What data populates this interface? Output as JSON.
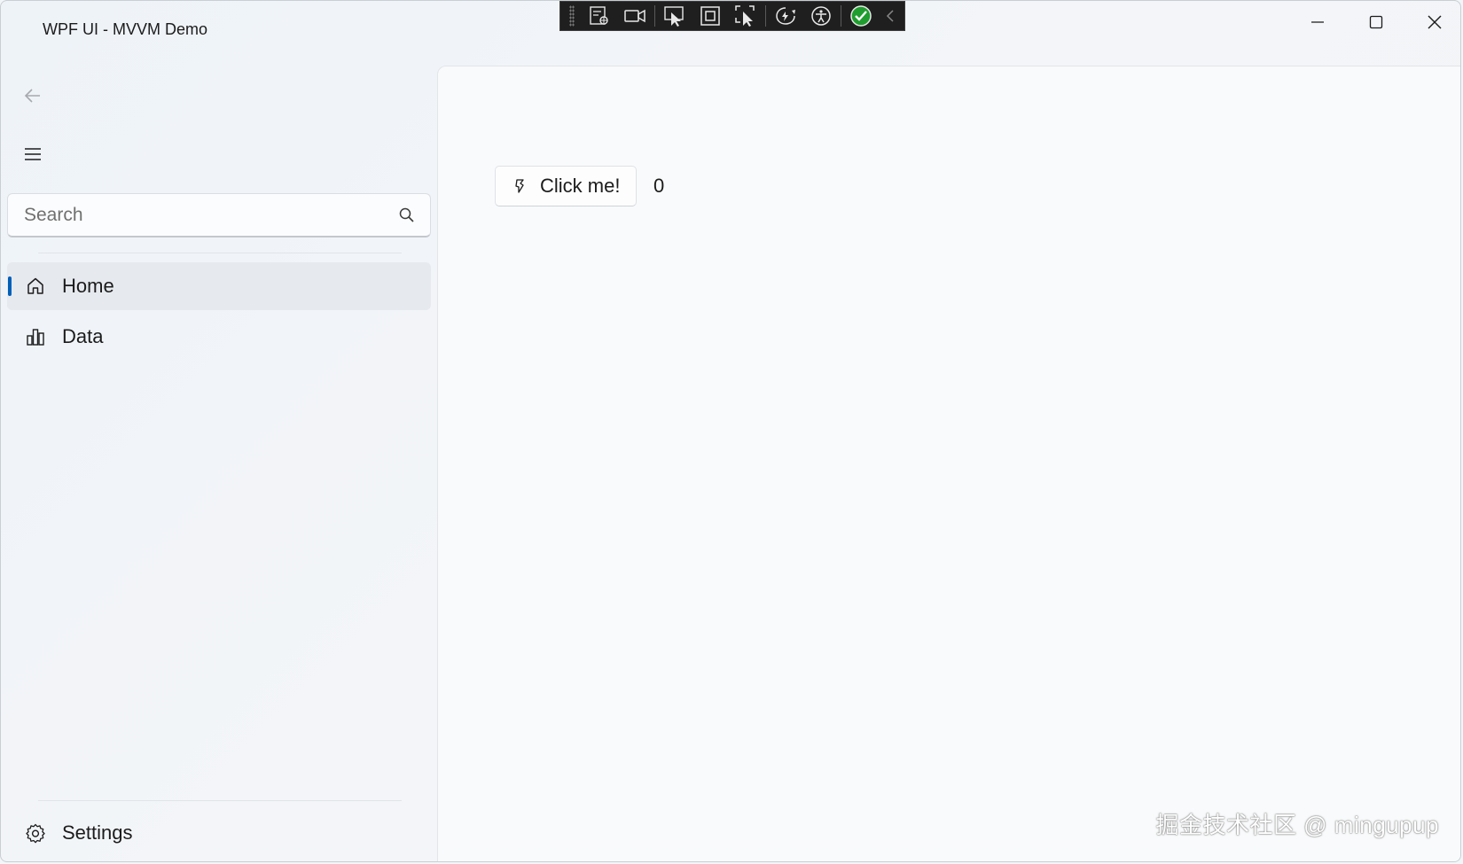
{
  "window": {
    "title": "WPF UI - MVVM Demo",
    "controls": [
      "minimize-icon",
      "maximize-icon",
      "close-icon"
    ]
  },
  "debug_toolbar": {
    "buttons": [
      "live-visual-tree-icon",
      "record-icon",
      "select-element-icon",
      "display-layout-adorners-icon",
      "track-focus-icon",
      "hot-reload-icon",
      "accessibility-icon",
      "binding-status-ok-icon",
      "collapse-chevron-icon"
    ]
  },
  "nav": {
    "search_placeholder": "Search",
    "items": [
      {
        "label": "Home",
        "icon": "home-icon",
        "selected": true
      },
      {
        "label": "Data",
        "icon": "bar-chart-icon",
        "selected": false
      }
    ],
    "footer": {
      "label": "Settings",
      "icon": "gear-icon"
    }
  },
  "content": {
    "button_label": "Click me!",
    "button_icon": "fluent-icon",
    "counter": "0"
  },
  "watermark": "掘金技术社区 @ mingupup",
  "colors": {
    "accent": "#005fb8",
    "toolbar_bg": "#1f1f1f",
    "ok_green": "#1f9d2f"
  }
}
